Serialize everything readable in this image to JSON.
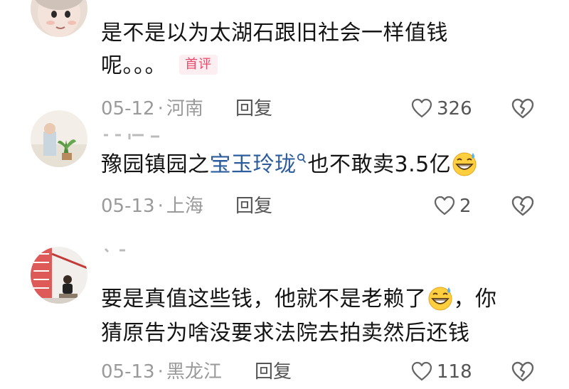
{
  "comments": [
    {
      "text_line1": "是不是以为太湖石跟旧社会一样值钱",
      "text_line2": "呢。。。",
      "badge": "首评",
      "date": "05-12",
      "dot": "·",
      "location": "河南",
      "reply_label": "回复",
      "likes": "326"
    },
    {
      "text_before": "豫园镇园之",
      "link_text": "宝玉玲珑",
      "text_after": "也不敢卖3.5亿",
      "date": "05-13",
      "dot": "·",
      "location": "上海",
      "reply_label": "回复",
      "likes": "2"
    },
    {
      "text_line1": "要是真值这些钱，他就不是老赖了",
      "text_line1_tail": "，你",
      "text_line2": "猜原告为啥没要求法院去拍卖然后还钱",
      "date": "05-13",
      "dot": "·",
      "location": "黑龙江",
      "reply_label": "回复",
      "likes": "118"
    }
  ],
  "icons": {
    "like": "heart-outline-icon",
    "dislike": "broken-heart-icon",
    "emoji": "grinning-sweat-emoji",
    "search": "search-icon"
  },
  "colors": {
    "text": "#141414",
    "meta": "#9a9a9a",
    "link": "#2d5d9c",
    "badge_text": "#e94a6a",
    "badge_bg": "#fdeef1"
  }
}
